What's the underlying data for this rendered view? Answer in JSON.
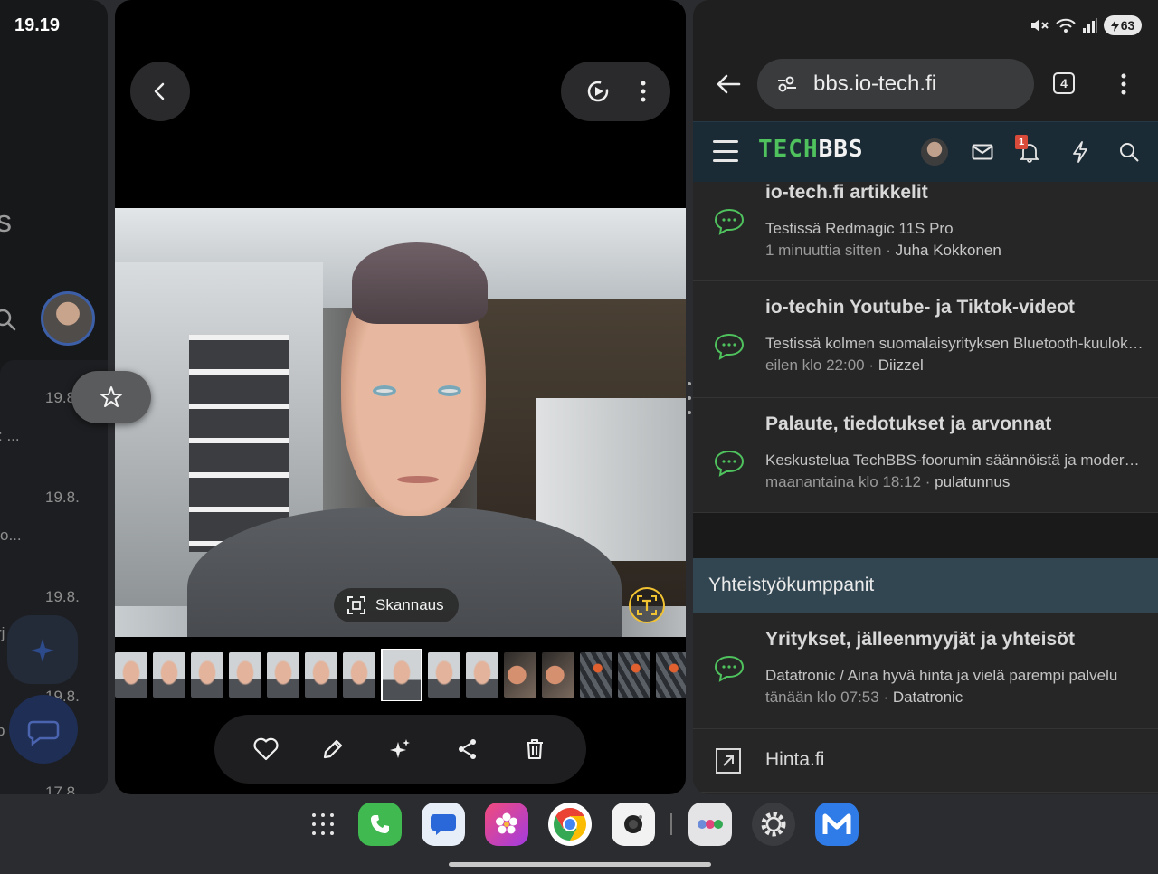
{
  "status_bar": {
    "time": "19.19",
    "battery": "63"
  },
  "left_panel": {
    "partial_heading": "s",
    "dates": [
      "19.8.",
      "19.8.",
      "19.8.",
      "19.8.",
      "17.8."
    ],
    "snippets": [
      ": ...",
      "o...",
      "rj",
      "p"
    ]
  },
  "photo_viewer": {
    "scan_label": "Skannaus",
    "thumbnails": [
      "face",
      "face",
      "face",
      "face",
      "face",
      "face",
      "face",
      "face",
      "face",
      "face",
      "hand",
      "hand",
      "tire",
      "tire",
      "tire"
    ],
    "selected_thumbnail": 7,
    "actions": [
      "heart-icon",
      "edit-icon",
      "sparkle-icon",
      "share-icon",
      "trash-icon"
    ]
  },
  "browser": {
    "url": "bbs.io-tech.fi",
    "tab_count": "4",
    "site": {
      "logo_tech": "TECH",
      "logo_bbs": "BBS",
      "notification_count": "1"
    },
    "forums": [
      {
        "title": "io-tech.fi artikkelit",
        "subtitle": "Testissä Redmagic 11S Pro",
        "time": "1 minuuttia sitten",
        "author": "Juha Kokkonen"
      },
      {
        "title": "io-techin Youtube- ja Tiktok-videot",
        "subtitle": "Testissä kolmen suomalaisyrityksen Bluetooth-kuulokkeet",
        "time": "eilen klo 22:00",
        "author": "Diizzel"
      },
      {
        "title": "Palaute, tiedotukset ja arvonnat",
        "subtitle": "Keskustelua TechBBS-foorumin säännöistä ja moderoinnista",
        "time": "maanantaina klo 18:12",
        "author": "pulatunnus"
      }
    ],
    "partners_header": "Yhteistyökumppanit",
    "partner_forum": {
      "title": "Yritykset, jälleenmyyjät ja yhteisöt",
      "subtitle": "Datatronic / Aina hyvä hinta ja vielä parempi palvelu",
      "time": "tänään klo 07:53",
      "author": "Datatronic"
    },
    "link_row": "Hinta.fi"
  },
  "dock": {
    "apps": [
      "phone",
      "messages",
      "gallery",
      "chrome",
      "camera",
      "app-folder",
      "settings",
      "mail"
    ]
  },
  "colors": {
    "accent_green": "#4fc25e",
    "header_bg": "#1b2b36",
    "partners_bg": "#324652",
    "notif_red": "#d84a3a"
  }
}
